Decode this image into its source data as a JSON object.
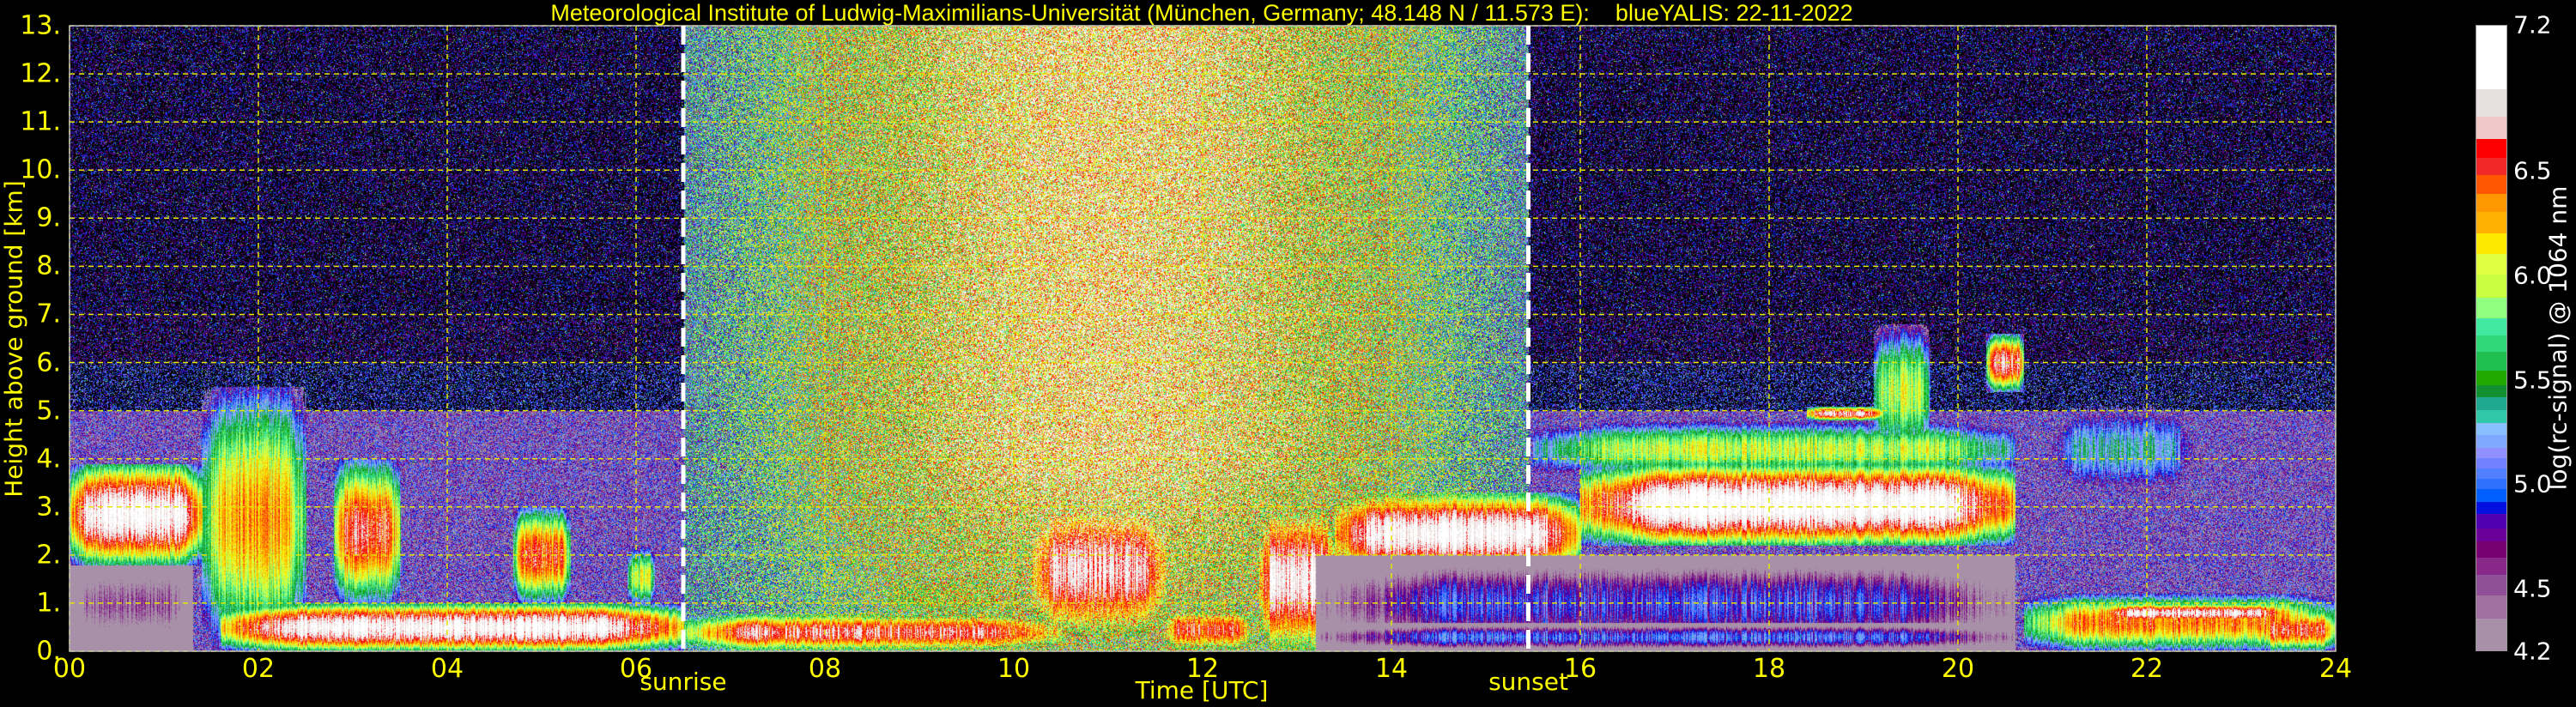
{
  "chart_data": {
    "type": "heatmap",
    "title": "Meteorological Institute of Ludwig-Maximilians-Universität (München, Germany; 48.148 N / 11.573 E):    blueYALIS: 22-11-2022",
    "xlabel": "Time [UTC]",
    "ylabel": "Height above ground [km]",
    "xlim": [
      0,
      24
    ],
    "ylim": [
      0,
      13
    ],
    "x_ticks": [
      0,
      2,
      4,
      6,
      8,
      10,
      12,
      14,
      16,
      18,
      20,
      22,
      24
    ],
    "x_tick_labels": [
      "00",
      "02",
      "04",
      "06",
      "08",
      "10",
      "12",
      "14",
      "16",
      "18",
      "20",
      "22",
      "24"
    ],
    "y_ticks": [
      0,
      1,
      2,
      3,
      4,
      5,
      6,
      7,
      8,
      9,
      10,
      11,
      12,
      13
    ],
    "y_tick_labels": [
      "0.",
      "1.",
      "2.",
      "3.",
      "4.",
      "5.",
      "6.",
      "7.",
      "8.",
      "9.",
      "10.",
      "11.",
      "12.",
      "13."
    ],
    "grid": true,
    "annotations": [
      {
        "label": "sunrise",
        "time": 6.5
      },
      {
        "label": "sunset",
        "time": 15.45
      }
    ],
    "colorbar": {
      "label": "log(rc-signal) @ 1064 nm",
      "range": [
        4.2,
        7.2
      ],
      "ticks": [
        4.2,
        4.5,
        5.0,
        5.5,
        6.0,
        6.5,
        7.2
      ],
      "tick_labels": [
        "4.2",
        "4.5",
        "5.0",
        "5.5",
        "6.0",
        "6.5",
        "7.2"
      ],
      "boundaries": [
        4.2,
        4.36,
        4.47,
        4.57,
        4.65,
        4.73,
        4.79,
        4.86,
        4.92,
        4.98,
        5.03,
        5.08,
        5.13,
        5.18,
        5.24,
        5.3,
        5.36,
        5.42,
        5.48,
        5.55,
        5.64,
        5.72,
        5.8,
        5.9,
        6.01,
        6.11,
        6.21,
        6.31,
        6.4,
        6.49,
        6.57,
        6.66,
        6.77,
        6.9,
        7.2
      ],
      "colors": [
        "#a890a8",
        "#a070a0",
        "#905098",
        "#882888",
        "#780070",
        "#6a0098",
        "#5000b0",
        "#0010e0",
        "#0060ff",
        "#3070ff",
        "#5080ff",
        "#7080ff",
        "#9090ff",
        "#80a8ff",
        "#88c0ff",
        "#30c8a8",
        "#20a890",
        "#109030",
        "#20a800",
        "#20c050",
        "#30d878",
        "#40e8a0",
        "#90ff80",
        "#c8ff40",
        "#e0ff40",
        "#ffe800",
        "#ffb000",
        "#ff9800",
        "#ff5800",
        "#f02828",
        "#ff0000",
        "#f0c8c8",
        "#e8e0e0",
        "#ffffff"
      ]
    },
    "features": [
      {
        "t0": 0.0,
        "t1": 1.3,
        "base": 0.0,
        "top": 2.0,
        "peak": 4.45
      },
      {
        "t0": 0.0,
        "t1": 1.4,
        "base": 1.8,
        "top": 3.9,
        "peak": 7.0
      },
      {
        "t0": 1.4,
        "t1": 2.5,
        "base": 0.0,
        "top": 5.5,
        "peak": 6.3
      },
      {
        "t0": 2.8,
        "t1": 3.5,
        "base": 1.0,
        "top": 4.0,
        "peak": 6.6
      },
      {
        "t0": 1.6,
        "t1": 6.5,
        "base": 0.0,
        "top": 1.0,
        "peak": 7.0
      },
      {
        "t0": 4.7,
        "t1": 5.3,
        "base": 1.0,
        "top": 3.0,
        "peak": 6.5
      },
      {
        "t0": 5.9,
        "t1": 6.2,
        "base": 0.9,
        "top": 2.2,
        "peak": 6.0
      },
      {
        "t0": 6.5,
        "t1": 10.5,
        "base": 0.0,
        "top": 0.8,
        "peak": 6.7
      },
      {
        "t0": 8.5,
        "t1": 10.0,
        "base": 0.5,
        "top": 1.8,
        "peak": 5.6
      },
      {
        "t0": 10.2,
        "t1": 11.6,
        "base": 0.3,
        "top": 3.1,
        "peak": 6.8
      },
      {
        "t0": 11.6,
        "t1": 12.5,
        "base": 0.0,
        "top": 0.9,
        "peak": 6.6
      },
      {
        "t0": 12.6,
        "t1": 13.4,
        "base": 0.0,
        "top": 3.0,
        "peak": 6.9
      },
      {
        "t0": 13.4,
        "t1": 16.0,
        "base": 1.6,
        "top": 3.3,
        "peak": 7.0
      },
      {
        "t0": 16.0,
        "t1": 20.6,
        "base": 2.2,
        "top": 3.9,
        "peak": 7.1
      },
      {
        "t0": 15.5,
        "t1": 20.6,
        "base": 3.6,
        "top": 4.8,
        "peak": 6.0
      },
      {
        "t0": 13.2,
        "t1": 20.6,
        "base": 0.0,
        "top": 2.0,
        "peak": 4.95
      },
      {
        "t0": 13.2,
        "t1": 20.6,
        "base": 0.0,
        "top": 0.6,
        "peak": 5.05
      },
      {
        "t0": 18.4,
        "t1": 19.2,
        "base": 4.8,
        "top": 5.1,
        "peak": 6.8
      },
      {
        "t0": 19.1,
        "t1": 19.7,
        "base": 4.0,
        "top": 6.8,
        "peak": 6.0
      },
      {
        "t0": 20.3,
        "t1": 20.7,
        "base": 5.4,
        "top": 6.6,
        "peak": 6.7
      },
      {
        "t0": 21.0,
        "t1": 22.5,
        "base": 3.2,
        "top": 5.2,
        "peak": 5.3
      },
      {
        "t0": 20.7,
        "t1": 24.0,
        "base": 0.0,
        "top": 1.2,
        "peak": 6.4
      },
      {
        "t0": 21.5,
        "t1": 23.5,
        "base": 0.6,
        "top": 1.0,
        "peak": 6.9
      },
      {
        "t0": 23.2,
        "t1": 24.0,
        "base": 0.0,
        "top": 0.9,
        "peak": 6.6
      }
    ]
  }
}
